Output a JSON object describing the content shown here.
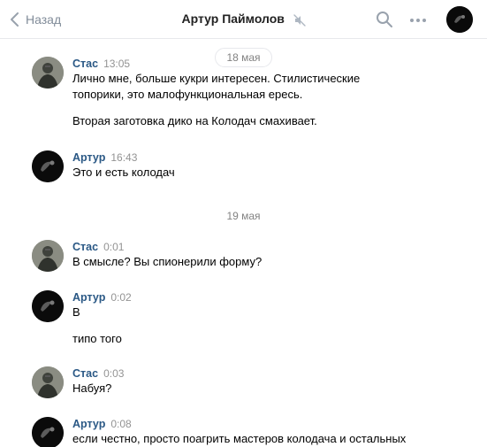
{
  "header": {
    "back_label": "Назад",
    "title": "Артур Паймолов",
    "icons": [
      "chevron-left-icon",
      "muted-icon",
      "search-icon",
      "more-icon"
    ]
  },
  "dates": [
    "18 мая",
    "19 мая"
  ],
  "messages": [
    {
      "author": "Стас",
      "time": "13:05",
      "lines": [
        "Лично мне, больше кукри интересен. Стилистические",
        "топорики, это малофункциональная ересь."
      ],
      "lines2": [
        "Вторая заготовка дико на Колодач смахивает."
      ]
    },
    {
      "author": "Артур",
      "time": "16:43",
      "lines": [
        "Это и есть колодач"
      ]
    },
    {
      "author": "Стас",
      "time": "0:01",
      "lines": [
        "В смысле? Вы спионерили форму?"
      ]
    },
    {
      "author": "Артур",
      "time": "0:02",
      "lines": [
        "В"
      ],
      "lines2": [
        "типо того"
      ]
    },
    {
      "author": "Стас",
      "time": "0:03",
      "lines": [
        "Набуя?"
      ]
    },
    {
      "author": "Артур",
      "time": "0:08",
      "lines": [
        "если честно, просто поагрить мастеров колодача и остальных"
      ]
    }
  ]
}
